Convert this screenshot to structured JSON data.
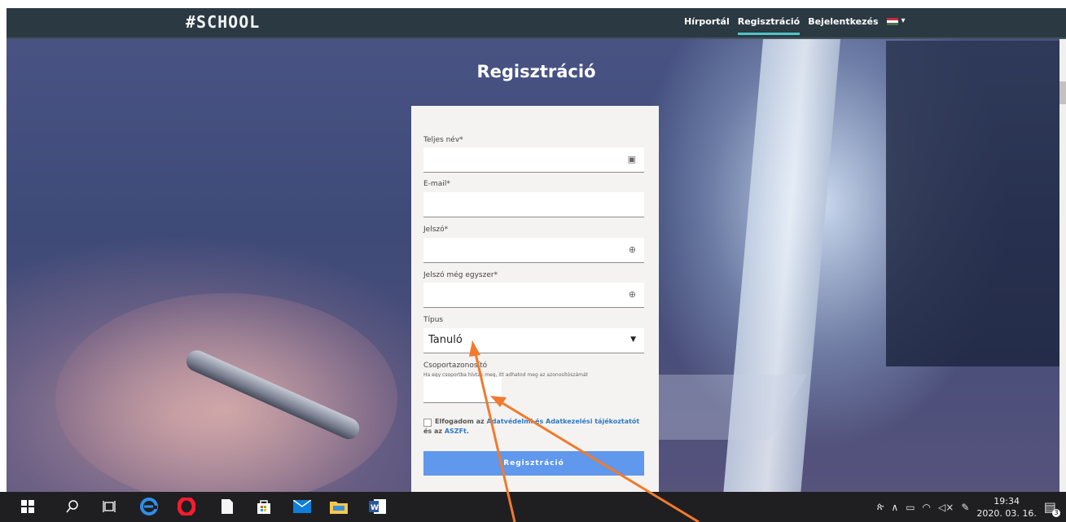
{
  "navbar": {
    "logo": "#SCHOOL",
    "links": [
      "Hírportál",
      "Regisztráció",
      "Bejelentkezés"
    ],
    "active_link": "Regisztráció",
    "language_caret": "▾"
  },
  "page": {
    "title": "Regisztráció"
  },
  "form": {
    "full_name_label": "Teljes név*",
    "email_label": "E-mail*",
    "password_label": "Jelszó*",
    "password_again_label": "Jelszó még egyszer*",
    "type_label": "Típus",
    "type_value": "Tanuló",
    "group_id_label": "Csoportazonosító",
    "group_id_hint": "Ha egy csoportba hívtak meg, itt adhatod meg az azonosítószámát",
    "terms_prefix": "Elfogadom az ",
    "terms_link1": "Adatvédelmi és Adatkezelési tájékoztatót",
    "terms_middle": " és az ",
    "terms_link2": "ASZFt",
    "terms_suffix": ".",
    "submit_label": "Regisztráció"
  },
  "taskbar": {
    "time": "19:34",
    "date": "2020. 03. 16.",
    "notification_count": "3",
    "icons": [
      "windows-start-icon",
      "search-icon",
      "task-view-icon",
      "edge-icon",
      "opera-icon",
      "file-icon",
      "store-icon",
      "mail-icon",
      "file-explorer-icon",
      "word-icon"
    ]
  },
  "colors": {
    "navbar": "#2b3942",
    "active_underline": "#4fc3c9",
    "submit": "#5f98ec",
    "link": "#2d7ac4",
    "annotation_arrow": "#f27a2c"
  }
}
